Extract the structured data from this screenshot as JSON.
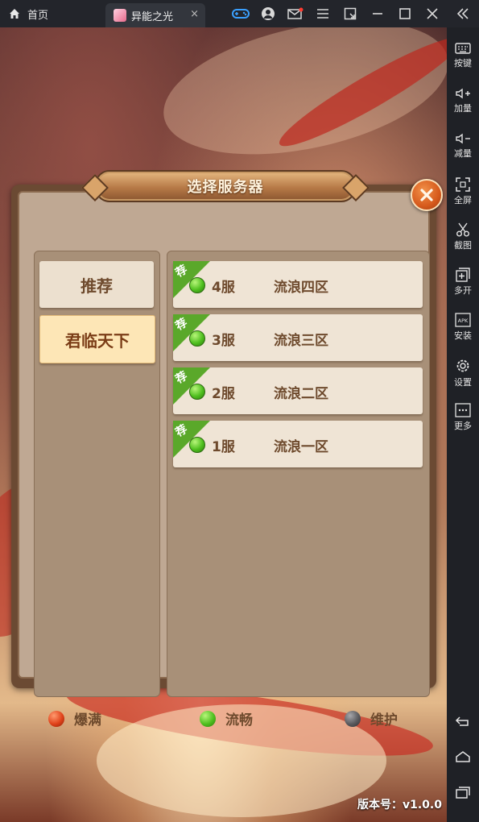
{
  "window": {
    "home_tab": "首页",
    "game_tab": "异能之光",
    "tab_close": "×"
  },
  "sidebar": {
    "items": [
      {
        "label": "按键",
        "icon": "keyboard-icon"
      },
      {
        "label": "加量",
        "icon": "volume-up-icon"
      },
      {
        "label": "减量",
        "icon": "volume-down-icon"
      },
      {
        "label": "全屏",
        "icon": "fullscreen-icon"
      },
      {
        "label": "截图",
        "icon": "scissors-icon"
      },
      {
        "label": "多开",
        "icon": "multi-instance-icon"
      },
      {
        "label": "安装",
        "icon": "apk-install-icon"
      },
      {
        "label": "设置",
        "icon": "gear-icon"
      },
      {
        "label": "更多",
        "icon": "more-icon"
      }
    ],
    "bottom": [
      "back-icon",
      "home-icon",
      "recent-apps-icon"
    ]
  },
  "dialog": {
    "title": "选择服务器",
    "categories": [
      {
        "label": "推荐",
        "active": false
      },
      {
        "label": "君临天下",
        "active": true
      }
    ],
    "servers": [
      {
        "tag": "荐",
        "number": "4服",
        "name": "流浪四区",
        "status": "流畅"
      },
      {
        "tag": "荐",
        "number": "3服",
        "name": "流浪三区",
        "status": "流畅"
      },
      {
        "tag": "荐",
        "number": "2服",
        "name": "流浪二区",
        "status": "流畅"
      },
      {
        "tag": "荐",
        "number": "1服",
        "name": "流浪一区",
        "status": "流畅"
      }
    ],
    "legend": [
      {
        "label": "爆满",
        "color": "#e0421a"
      },
      {
        "label": "流畅",
        "color": "#4fbf1f"
      },
      {
        "label": "维护",
        "color": "#5a5a5e"
      }
    ]
  },
  "version": "版本号：v1.0.0",
  "colors": {
    "accent_blue": "#3aa0ff",
    "status_green": "#4fbf1f",
    "status_red": "#e0421a",
    "status_gray": "#5a5a5e",
    "close_orange": "#d65a1c"
  }
}
